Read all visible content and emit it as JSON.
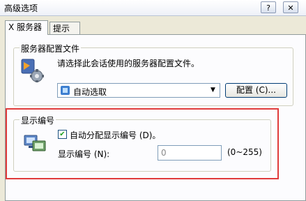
{
  "window": {
    "title": "高级选项",
    "help_label": "?",
    "close_label": "✕"
  },
  "tabs": [
    {
      "label": "X 服务器"
    },
    {
      "label": "提示"
    }
  ],
  "server_config": {
    "group_label": "服务器配置文件",
    "description": "请选择此会话使用的服务器配置文件。",
    "combo_value": "自动选取",
    "config_button": "配置 (C)..."
  },
  "display_number": {
    "group_label": "显示编号",
    "auto_assign_label": "自动分配显示编号 (D)。",
    "auto_assign_checked": true,
    "number_label": "显示编号 (N):",
    "number_value": "0",
    "range_hint": "(0~255)"
  },
  "highlight_color": "#e03b3b"
}
